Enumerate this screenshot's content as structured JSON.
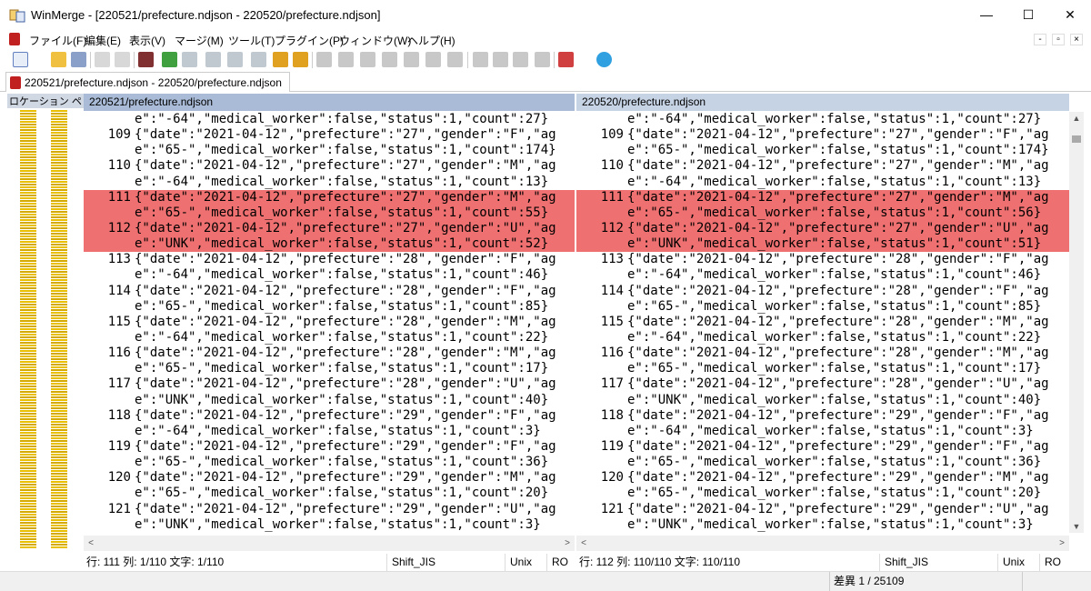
{
  "window": {
    "title": "WinMerge - [220521/prefecture.ndjson - 220520/prefecture.ndjson]",
    "min_glyph": "—",
    "max_glyph": "☐",
    "close_glyph": "✕"
  },
  "menu": {
    "items": [
      "ファイル(F)",
      "編集(E)",
      "表示(V)",
      "マージ(M)",
      "ツール(T)",
      "プラグイン(P)",
      "ウィンドウ(W)",
      "ヘルプ(H)"
    ],
    "mdi_min": "-",
    "mdi_restore": "▫",
    "mdi_close": "×"
  },
  "tab": {
    "label": "220521/prefecture.ndjson - 220520/prefecture.ndjson"
  },
  "location": {
    "header": "ロケーション ペ"
  },
  "left_pane": {
    "path": "220521/prefecture.ndjson",
    "lines": [
      {
        "num": "",
        "text": "e\":\"-64\",\"medical_worker\":false,\"status\":1,\"count\":27}",
        "diff": false
      },
      {
        "num": "109",
        "text": "{\"date\":\"2021-04-12\",\"prefecture\":\"27\",\"gender\":\"F\",\"ag",
        "diff": false
      },
      {
        "num": "",
        "text": "e\":\"65-\",\"medical_worker\":false,\"status\":1,\"count\":174}",
        "diff": false
      },
      {
        "num": "110",
        "text": "{\"date\":\"2021-04-12\",\"prefecture\":\"27\",\"gender\":\"M\",\"ag",
        "diff": false
      },
      {
        "num": "",
        "text": "e\":\"-64\",\"medical_worker\":false,\"status\":1,\"count\":13}",
        "diff": false
      },
      {
        "num": "111",
        "text": "{\"date\":\"2021-04-12\",\"prefecture\":\"27\",\"gender\":\"M\",\"ag",
        "diff": true
      },
      {
        "num": "",
        "text": "e\":\"65-\",\"medical_worker\":false,\"status\":1,\"count\":55}",
        "diff": true
      },
      {
        "num": "112",
        "text": "{\"date\":\"2021-04-12\",\"prefecture\":\"27\",\"gender\":\"U\",\"ag",
        "diff": true
      },
      {
        "num": "",
        "text": "e\":\"UNK\",\"medical_worker\":false,\"status\":1,\"count\":52}",
        "diff": true
      },
      {
        "num": "113",
        "text": "{\"date\":\"2021-04-12\",\"prefecture\":\"28\",\"gender\":\"F\",\"ag",
        "diff": false
      },
      {
        "num": "",
        "text": "e\":\"-64\",\"medical_worker\":false,\"status\":1,\"count\":46}",
        "diff": false
      },
      {
        "num": "114",
        "text": "{\"date\":\"2021-04-12\",\"prefecture\":\"28\",\"gender\":\"F\",\"ag",
        "diff": false
      },
      {
        "num": "",
        "text": "e\":\"65-\",\"medical_worker\":false,\"status\":1,\"count\":85}",
        "diff": false
      },
      {
        "num": "115",
        "text": "{\"date\":\"2021-04-12\",\"prefecture\":\"28\",\"gender\":\"M\",\"ag",
        "diff": false
      },
      {
        "num": "",
        "text": "e\":\"-64\",\"medical_worker\":false,\"status\":1,\"count\":22}",
        "diff": false
      },
      {
        "num": "116",
        "text": "{\"date\":\"2021-04-12\",\"prefecture\":\"28\",\"gender\":\"M\",\"ag",
        "diff": false
      },
      {
        "num": "",
        "text": "e\":\"65-\",\"medical_worker\":false,\"status\":1,\"count\":17}",
        "diff": false
      },
      {
        "num": "117",
        "text": "{\"date\":\"2021-04-12\",\"prefecture\":\"28\",\"gender\":\"U\",\"ag",
        "diff": false
      },
      {
        "num": "",
        "text": "e\":\"UNK\",\"medical_worker\":false,\"status\":1,\"count\":40}",
        "diff": false
      },
      {
        "num": "118",
        "text": "{\"date\":\"2021-04-12\",\"prefecture\":\"29\",\"gender\":\"F\",\"ag",
        "diff": false
      },
      {
        "num": "",
        "text": "e\":\"-64\",\"medical_worker\":false,\"status\":1,\"count\":3}",
        "diff": false
      },
      {
        "num": "119",
        "text": "{\"date\":\"2021-04-12\",\"prefecture\":\"29\",\"gender\":\"F\",\"ag",
        "diff": false
      },
      {
        "num": "",
        "text": "e\":\"65-\",\"medical_worker\":false,\"status\":1,\"count\":36}",
        "diff": false
      },
      {
        "num": "120",
        "text": "{\"date\":\"2021-04-12\",\"prefecture\":\"29\",\"gender\":\"M\",\"ag",
        "diff": false
      },
      {
        "num": "",
        "text": "e\":\"65-\",\"medical_worker\":false,\"status\":1,\"count\":20}",
        "diff": false
      },
      {
        "num": "121",
        "text": "{\"date\":\"2021-04-12\",\"prefecture\":\"29\",\"gender\":\"U\",\"ag",
        "diff": false
      },
      {
        "num": "",
        "text": "e\":\"UNK\",\"medical_worker\":false,\"status\":1,\"count\":3}",
        "diff": false
      }
    ]
  },
  "right_pane": {
    "path": "220520/prefecture.ndjson",
    "lines": [
      {
        "num": "",
        "text": "e\":\"-64\",\"medical_worker\":false,\"status\":1,\"count\":27}",
        "diff": false
      },
      {
        "num": "109",
        "text": "{\"date\":\"2021-04-12\",\"prefecture\":\"27\",\"gender\":\"F\",\"ag",
        "diff": false
      },
      {
        "num": "",
        "text": "e\":\"65-\",\"medical_worker\":false,\"status\":1,\"count\":174}",
        "diff": false
      },
      {
        "num": "110",
        "text": "{\"date\":\"2021-04-12\",\"prefecture\":\"27\",\"gender\":\"M\",\"ag",
        "diff": false
      },
      {
        "num": "",
        "text": "e\":\"-64\",\"medical_worker\":false,\"status\":1,\"count\":13}",
        "diff": false
      },
      {
        "num": "111",
        "text": "{\"date\":\"2021-04-12\",\"prefecture\":\"27\",\"gender\":\"M\",\"ag",
        "diff": true
      },
      {
        "num": "",
        "text": "e\":\"65-\",\"medical_worker\":false,\"status\":1,\"count\":56}",
        "diff": true
      },
      {
        "num": "112",
        "text": "{\"date\":\"2021-04-12\",\"prefecture\":\"27\",\"gender\":\"U\",\"ag",
        "diff": true
      },
      {
        "num": "",
        "text": "e\":\"UNK\",\"medical_worker\":false,\"status\":1,\"count\":51}",
        "diff": true
      },
      {
        "num": "113",
        "text": "{\"date\":\"2021-04-12\",\"prefecture\":\"28\",\"gender\":\"F\",\"ag",
        "diff": false
      },
      {
        "num": "",
        "text": "e\":\"-64\",\"medical_worker\":false,\"status\":1,\"count\":46}",
        "diff": false
      },
      {
        "num": "114",
        "text": "{\"date\":\"2021-04-12\",\"prefecture\":\"28\",\"gender\":\"F\",\"ag",
        "diff": false
      },
      {
        "num": "",
        "text": "e\":\"65-\",\"medical_worker\":false,\"status\":1,\"count\":85}",
        "diff": false
      },
      {
        "num": "115",
        "text": "{\"date\":\"2021-04-12\",\"prefecture\":\"28\",\"gender\":\"M\",\"ag",
        "diff": false
      },
      {
        "num": "",
        "text": "e\":\"-64\",\"medical_worker\":false,\"status\":1,\"count\":22}",
        "diff": false
      },
      {
        "num": "116",
        "text": "{\"date\":\"2021-04-12\",\"prefecture\":\"28\",\"gender\":\"M\",\"ag",
        "diff": false
      },
      {
        "num": "",
        "text": "e\":\"65-\",\"medical_worker\":false,\"status\":1,\"count\":17}",
        "diff": false
      },
      {
        "num": "117",
        "text": "{\"date\":\"2021-04-12\",\"prefecture\":\"28\",\"gender\":\"U\",\"ag",
        "diff": false
      },
      {
        "num": "",
        "text": "e\":\"UNK\",\"medical_worker\":false,\"status\":1,\"count\":40}",
        "diff": false
      },
      {
        "num": "118",
        "text": "{\"date\":\"2021-04-12\",\"prefecture\":\"29\",\"gender\":\"F\",\"ag",
        "diff": false
      },
      {
        "num": "",
        "text": "e\":\"-64\",\"medical_worker\":false,\"status\":1,\"count\":3}",
        "diff": false
      },
      {
        "num": "119",
        "text": "{\"date\":\"2021-04-12\",\"prefecture\":\"29\",\"gender\":\"F\",\"ag",
        "diff": false
      },
      {
        "num": "",
        "text": "e\":\"65-\",\"medical_worker\":false,\"status\":1,\"count\":36}",
        "diff": false
      },
      {
        "num": "120",
        "text": "{\"date\":\"2021-04-12\",\"prefecture\":\"29\",\"gender\":\"M\",\"ag",
        "diff": false
      },
      {
        "num": "",
        "text": "e\":\"65-\",\"medical_worker\":false,\"status\":1,\"count\":20}",
        "diff": false
      },
      {
        "num": "121",
        "text": "{\"date\":\"2021-04-12\",\"prefecture\":\"29\",\"gender\":\"U\",\"ag",
        "diff": false
      },
      {
        "num": "",
        "text": "e\":\"UNK\",\"medical_worker\":false,\"status\":1,\"count\":3}",
        "diff": false
      }
    ]
  },
  "status_left": {
    "position": "行: 111  列: 1/110  文字: 1/110",
    "encoding": "Shift_JIS",
    "eol": "Unix",
    "ro": "RO"
  },
  "status_right": {
    "position": "行: 112  列: 110/110  文字: 110/110",
    "encoding": "Shift_JIS",
    "eol": "Unix",
    "ro": "RO"
  },
  "bottom": {
    "diff_count": "差異 1 / 25109"
  },
  "colors": {
    "diff_bg": "#ef7070",
    "left_header": "#a9bbd6",
    "right_header": "#c6d3e4",
    "location_bar": "#e8c000"
  },
  "scroll_arrows": {
    "up": "▲",
    "down": "▼",
    "left": "<",
    "right": ">"
  }
}
